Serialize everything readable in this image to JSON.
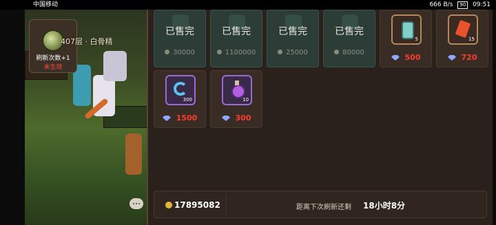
{
  "status_bar": {
    "carrier": "中国移动",
    "network_speed": "666 B/s",
    "battery": "90",
    "time": "09:51"
  },
  "scene": {
    "badge_title": "刷新次数+1",
    "badge_status": "未生效",
    "floor_label": "407层 · 白骨精"
  },
  "shop": {
    "items": [
      {
        "state": "sold",
        "label": "已售完",
        "price": "30000",
        "currency": "coin"
      },
      {
        "state": "sold",
        "label": "已售完",
        "price": "1100000",
        "currency": "coin"
      },
      {
        "state": "sold",
        "label": "已售完",
        "price": "25000",
        "currency": "coin"
      },
      {
        "state": "sold",
        "label": "已售完",
        "price": "80000",
        "currency": "coin"
      },
      {
        "state": "available",
        "icon": "potion-bottle-icon",
        "qty": "5",
        "price": "500",
        "currency": "gem"
      },
      {
        "state": "available",
        "icon": "red-crystal-icon",
        "qty": "15",
        "price": "720",
        "currency": "gem"
      },
      {
        "state": "available",
        "icon": "blue-swirl-icon",
        "qty": "300",
        "price": "1500",
        "currency": "gem"
      },
      {
        "state": "available",
        "icon": "purple-potion-icon",
        "qty": "10",
        "price": "300",
        "currency": "gem"
      }
    ]
  },
  "footer": {
    "coins": "17895082",
    "next_refresh_label": "距离下次刷新还剩",
    "next_refresh_time": "18小时8分"
  },
  "colors": {
    "price_red": "#ff3b2f",
    "panel_bg": "#2b211c",
    "sold_card_bg": "#2c3c36",
    "gem_blue": "#8fa8ff"
  }
}
